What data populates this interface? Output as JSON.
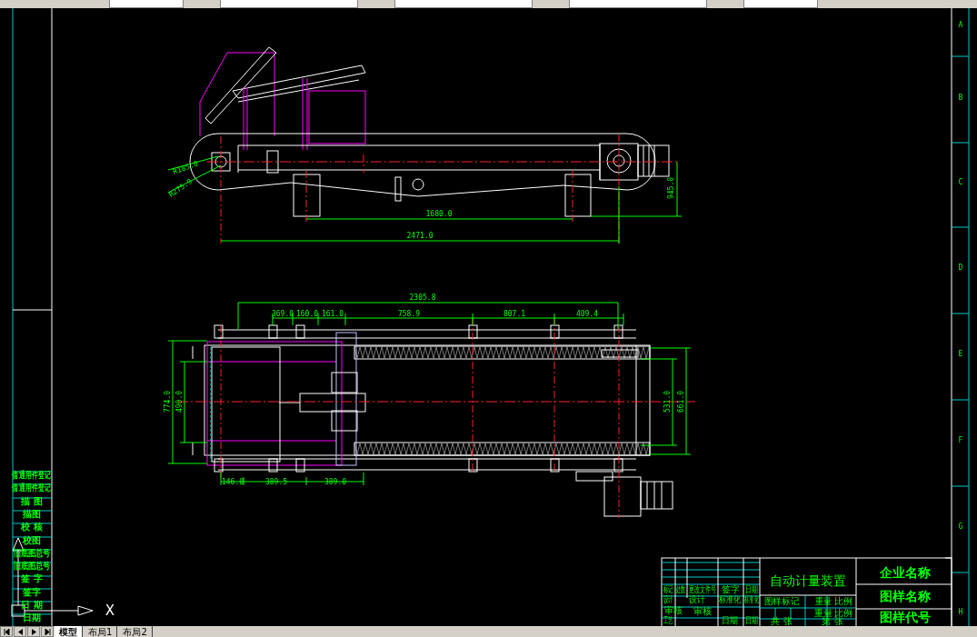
{
  "front_view_dimensions": [
    "R185.0",
    "R275.9",
    "1680.0",
    "2471.0",
    "945.0"
  ],
  "plan_view_dimensions": [
    "2305.8",
    "369.0",
    "160.0",
    "161.0",
    "758.9",
    "807.1",
    "409.4",
    "774.0",
    "490.0",
    "531.0",
    "661.0",
    "146.0",
    "389.5",
    "389.0"
  ],
  "zone_letters": [
    "A",
    "B",
    "C",
    "D",
    "E",
    "F",
    "G",
    "H"
  ],
  "side_labels": [
    "借通用件登记",
    "借通用件登记",
    "描 图",
    "描图",
    "校 核",
    "校图",
    "旧底图总号",
    "旧底图总号",
    "签 字",
    "签字",
    "日 期",
    "日期"
  ],
  "title_block": {
    "title": "自动计量装置",
    "company": "企业名称",
    "drawing_name": "图样名称",
    "drawing_number": "图样代号",
    "cells": [
      "标记",
      "处数",
      "更改文件号",
      "签字",
      "日期",
      "设计",
      "设计",
      "标准化",
      "标准化",
      "审核",
      "审核",
      "工艺",
      "日期",
      "日期",
      "图样标记",
      "重量",
      "比例",
      "重量",
      "比例",
      "共 张",
      "第 张"
    ]
  },
  "ucs_axis": "X",
  "layout_tabs": [
    {
      "label": "模型",
      "selected": true
    },
    {
      "label": "布局1",
      "selected": false
    },
    {
      "label": "布局2",
      "selected": false
    }
  ]
}
